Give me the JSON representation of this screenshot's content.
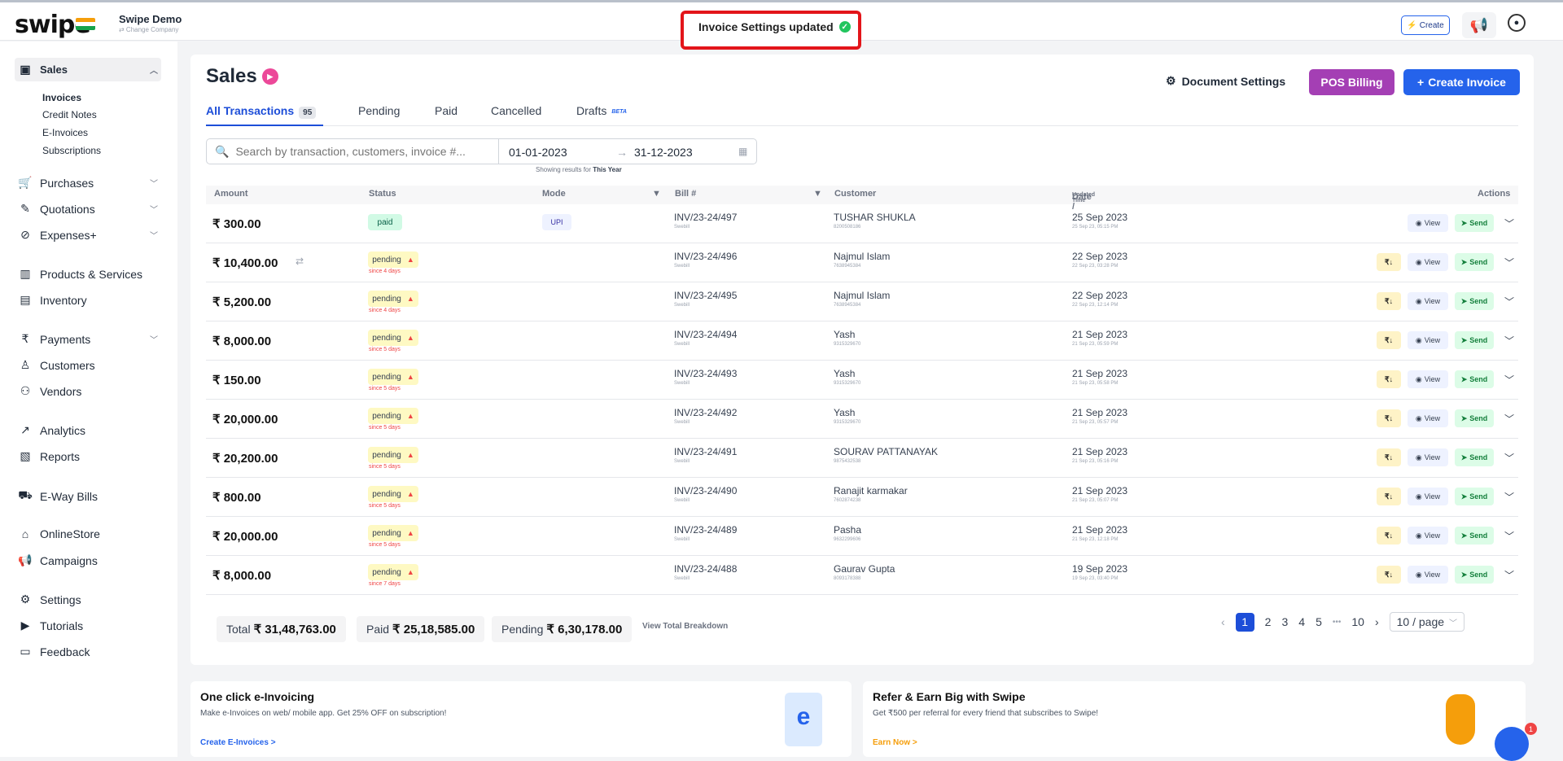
{
  "brand": {
    "logo": "swipe",
    "company_name": "Swipe Demo",
    "change_company": "⇄ Change Company"
  },
  "toast": {
    "text": "Invoice Settings updated"
  },
  "topbar": {
    "create_label": "Create"
  },
  "sidebar": {
    "sales": "Sales",
    "sub": [
      "Invoices",
      "Credit Notes",
      "E-Invoices",
      "Subscriptions"
    ],
    "items": [
      {
        "label": "Purchases",
        "icon": "cart-icon"
      },
      {
        "label": "Quotations",
        "icon": "pen-icon"
      },
      {
        "label": "Expenses+",
        "icon": "tag-icon"
      },
      {
        "label": "Products & Services",
        "icon": "barcode-icon"
      },
      {
        "label": "Inventory",
        "icon": "inventory-icon"
      },
      {
        "label": "Payments",
        "icon": "rupee-icon"
      },
      {
        "label": "Customers",
        "icon": "user-icon"
      },
      {
        "label": "Vendors",
        "icon": "users-icon"
      },
      {
        "label": "Analytics",
        "icon": "chart-icon"
      },
      {
        "label": "Reports",
        "icon": "report-icon"
      },
      {
        "label": "E-Way Bills",
        "icon": "truck-icon"
      },
      {
        "label": "OnlineStore",
        "icon": "store-icon"
      },
      {
        "label": "Campaigns",
        "icon": "megaphone-icon"
      },
      {
        "label": "Settings",
        "icon": "gear-icon"
      },
      {
        "label": "Tutorials",
        "icon": "youtube-icon"
      },
      {
        "label": "Feedback",
        "icon": "chat-icon"
      }
    ]
  },
  "header": {
    "title": "Sales",
    "doc_settings": "Document Settings",
    "pos_billing": "POS Billing",
    "create_invoice": "Create Invoice"
  },
  "tabs": [
    {
      "label": "All Transactions",
      "count": "95"
    },
    {
      "label": "Pending"
    },
    {
      "label": "Paid"
    },
    {
      "label": "Cancelled"
    },
    {
      "label": "Drafts",
      "badge": "BETA"
    }
  ],
  "search": {
    "placeholder": "Search by transaction, customers, invoice #..."
  },
  "dates": {
    "from": "01-01-2023",
    "arrow": "→",
    "to": "31-12-2023",
    "showing_prefix": "Showing results for",
    "showing_period": "This Year"
  },
  "columns": {
    "amount": "Amount",
    "status": "Status",
    "mode": "Mode",
    "bill": "Bill #",
    "customer": "Customer",
    "date": "Date /",
    "date_sub": "Updated Time",
    "actions": "Actions"
  },
  "rows": [
    {
      "amount": "₹ 300.00",
      "status": "paid",
      "mode": "UPI",
      "bill": "INV/23-24/497",
      "bill_sub": "Swebill",
      "customer": "TUSHAR SHUKLA",
      "phone": "8200508186",
      "date": "25 Sep 2023",
      "updated": "25 Sep 23, 05:15 PM"
    },
    {
      "amount": "₹ 10,400.00",
      "status": "pending",
      "since": "since 4 days",
      "bill": "INV/23-24/496",
      "bill_sub": "Swebill",
      "customer": "Najmul Islam",
      "phone": "7638945384",
      "date": "22 Sep 2023",
      "updated": "22 Sep 23, 03:28 PM"
    },
    {
      "amount": "₹ 5,200.00",
      "status": "pending",
      "since": "since 4 days",
      "bill": "INV/23-24/495",
      "bill_sub": "Swebill",
      "customer": "Najmul Islam",
      "phone": "7638945384",
      "date": "22 Sep 2023",
      "updated": "22 Sep 23, 12:14 PM"
    },
    {
      "amount": "₹ 8,000.00",
      "status": "pending",
      "since": "since 5 days",
      "bill": "INV/23-24/494",
      "bill_sub": "Swebill",
      "customer": "Yash",
      "phone": "9315329670",
      "date": "21 Sep 2023",
      "updated": "21 Sep 23, 05:59 PM"
    },
    {
      "amount": "₹ 150.00",
      "status": "pending",
      "since": "since 5 days",
      "bill": "INV/23-24/493",
      "bill_sub": "Swebill",
      "customer": "Yash",
      "phone": "9315329670",
      "date": "21 Sep 2023",
      "updated": "21 Sep 23, 05:58 PM"
    },
    {
      "amount": "₹ 20,000.00",
      "status": "pending",
      "since": "since 5 days",
      "bill": "INV/23-24/492",
      "bill_sub": "Swebill",
      "customer": "Yash",
      "phone": "9315329670",
      "date": "21 Sep 2023",
      "updated": "21 Sep 23, 05:57 PM"
    },
    {
      "amount": "₹ 20,200.00",
      "status": "pending",
      "since": "since 5 days",
      "bill": "INV/23-24/491",
      "bill_sub": "Swebill",
      "customer": "SOURAV PATTANAYAK",
      "phone": "9875432538",
      "date": "21 Sep 2023",
      "updated": "21 Sep 23, 05:16 PM"
    },
    {
      "amount": "₹ 800.00",
      "status": "pending",
      "since": "since 5 days",
      "bill": "INV/23-24/490",
      "bill_sub": "Swebill",
      "customer": "Ranajit karmakar",
      "phone": "7602874238",
      "date": "21 Sep 2023",
      "updated": "21 Sep 23, 05:07 PM"
    },
    {
      "amount": "₹ 20,000.00",
      "status": "pending",
      "since": "since 5 days",
      "bill": "INV/23-24/489",
      "bill_sub": "Swebill",
      "customer": "Pasha",
      "phone": "9632299606",
      "date": "21 Sep 2023",
      "updated": "21 Sep 23, 12:18 PM"
    },
    {
      "amount": "₹ 8,000.00",
      "status": "pending",
      "since": "since 7 days",
      "bill": "INV/23-24/488",
      "bill_sub": "Swebill",
      "customer": "Gaurav Gupta",
      "phone": "8093178388",
      "date": "19 Sep 2023",
      "updated": "19 Sep 23, 03:40 PM"
    }
  ],
  "actions": {
    "view": "View",
    "send": "Send",
    "rs": "₹↓"
  },
  "totals": {
    "total_label": "Total",
    "total": "₹ 31,48,763.00",
    "paid_label": "Paid",
    "paid": "₹ 25,18,585.00",
    "pending_label": "Pending",
    "pending": "₹ 6,30,178.00",
    "breakdown": "View Total Breakdown"
  },
  "pagination": {
    "pages": [
      "1",
      "2",
      "3",
      "4",
      "5",
      "•••",
      "10"
    ],
    "per_page": "10 / page"
  },
  "promo1": {
    "title": "One click e-Invoicing",
    "text": "Make e-Invoices on web/ mobile app. Get 25% OFF on subscription!",
    "link": "Create E-Invoices >"
  },
  "promo2": {
    "title": "Refer & Earn Big with Swipe",
    "text": "Get ₹500 per referral for every friend that subscribes to Swipe!",
    "link": "Earn Now >"
  },
  "chat": {
    "badge": "1"
  },
  "colors": {
    "primary": "#2563eb",
    "pos": "#a43fb4",
    "highlight": "#e3151a"
  }
}
